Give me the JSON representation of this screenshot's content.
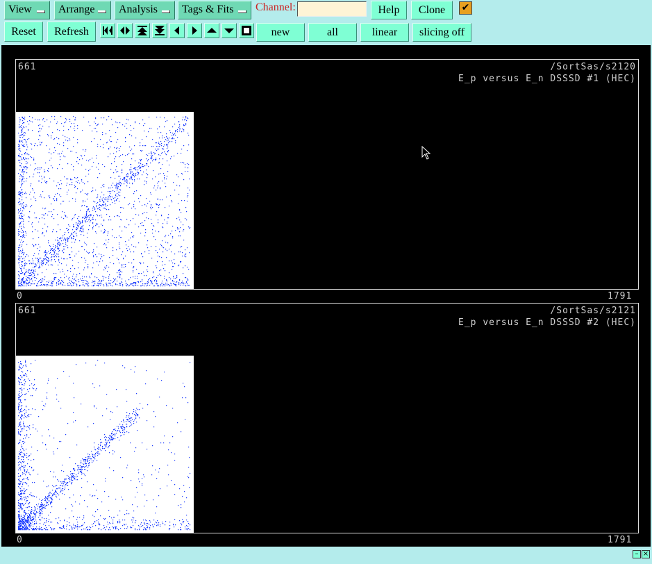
{
  "menus": [
    {
      "label": "View"
    },
    {
      "label": "Arrange"
    },
    {
      "label": "Analysis"
    },
    {
      "label": "Tags & Fits"
    }
  ],
  "channel": {
    "label": "Channel:",
    "value": ""
  },
  "buttons": {
    "help": "Help",
    "clone": "Clone",
    "reset": "Reset",
    "refresh": "Refresh",
    "new": "new",
    "all": "all",
    "linear": "linear",
    "slicing": "slicing off"
  },
  "checkbox": {
    "checked": true,
    "glyph": "✔"
  },
  "nav_icons": [
    "first-icon",
    "expand-horizontal-icon",
    "scroll-top-icon",
    "scroll-bottom-icon",
    "step-left-icon",
    "step-right-icon",
    "step-up-icon",
    "step-down-icon",
    "stop-square-icon"
  ],
  "panels": [
    {
      "y_max": "661",
      "path": "/SortSas/s2120",
      "title": "E_p versus E_n DSSSD #1 (HEC)",
      "x_min": "0",
      "x_max": "1791",
      "density": "high"
    },
    {
      "y_max": "661",
      "path": "/SortSas/s2121",
      "title": "E_p versus E_n DSSSD #2 (HEC)",
      "x_min": "0",
      "x_max": "1791",
      "density": "low"
    }
  ],
  "colors": {
    "background": "#b4ecec",
    "button": "#7fffd4",
    "menu": "#6fd9b4",
    "points": "#1f3fff",
    "display": "#000000"
  }
}
